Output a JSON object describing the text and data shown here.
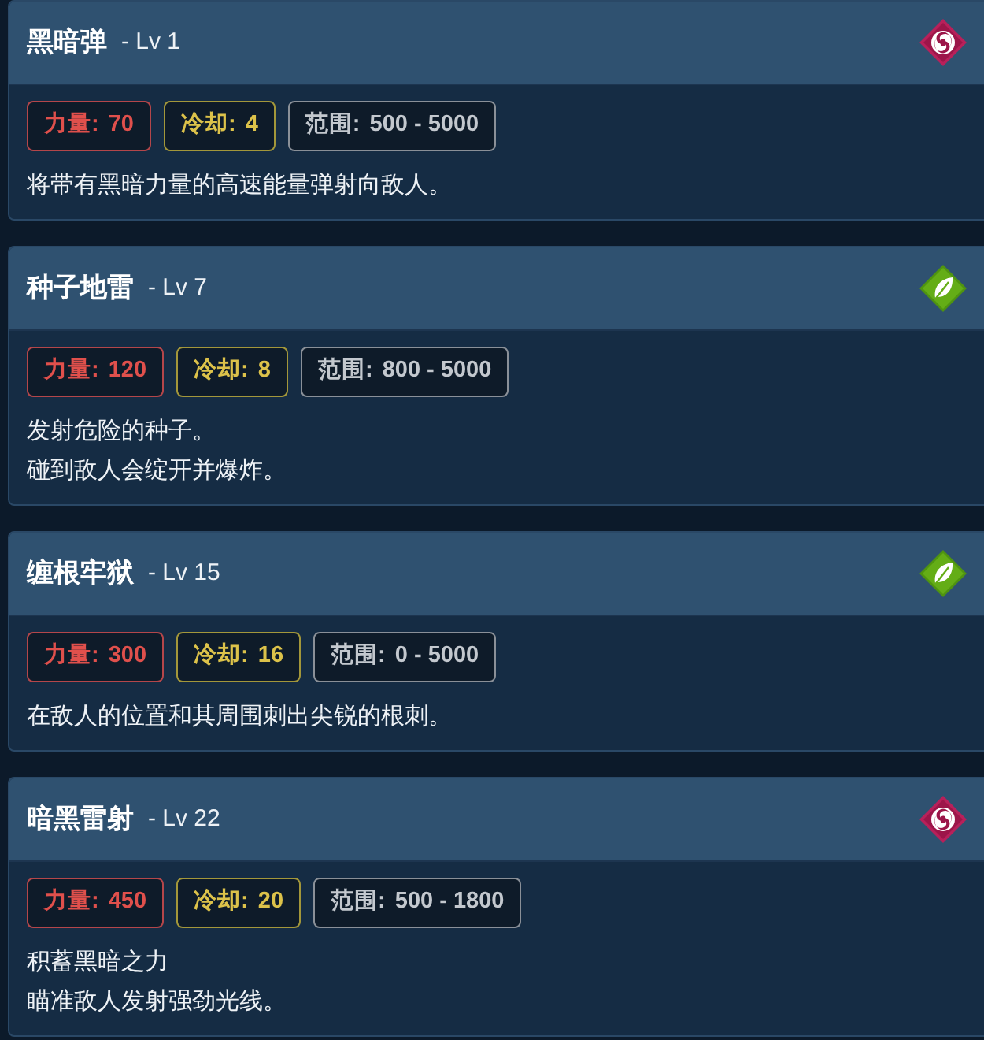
{
  "skills": [
    {
      "name": "黑暗弹",
      "level_text": "- Lv 1",
      "kind": "dark",
      "stats": [
        {
          "kind": "power",
          "label": "力量:",
          "value": "70"
        },
        {
          "kind": "cooldown",
          "label": "冷却:",
          "value": "4"
        },
        {
          "kind": "range",
          "label": "范围:",
          "value": "500 - 5000"
        }
      ],
      "description_lines": [
        "将带有黑暗力量的高速能量弹射向敌人。"
      ]
    },
    {
      "name": "种子地雷",
      "level_text": "- Lv 7",
      "kind": "nature",
      "stats": [
        {
          "kind": "power",
          "label": "力量:",
          "value": "120"
        },
        {
          "kind": "cooldown",
          "label": "冷却:",
          "value": "8"
        },
        {
          "kind": "range",
          "label": "范围:",
          "value": "800 - 5000"
        }
      ],
      "description_lines": [
        "发射危险的种子。",
        "碰到敌人会绽开并爆炸。"
      ]
    },
    {
      "name": "缠根牢狱",
      "level_text": "- Lv 15",
      "kind": "nature",
      "stats": [
        {
          "kind": "power",
          "label": "力量:",
          "value": "300"
        },
        {
          "kind": "cooldown",
          "label": "冷却:",
          "value": "16"
        },
        {
          "kind": "range",
          "label": "范围:",
          "value": "0 - 5000"
        }
      ],
      "description_lines": [
        "在敌人的位置和其周围刺出尖锐的根刺。"
      ]
    },
    {
      "name": "暗黑雷射",
      "level_text": "- Lv 22",
      "kind": "dark",
      "stats": [
        {
          "kind": "power",
          "label": "力量:",
          "value": "450"
        },
        {
          "kind": "cooldown",
          "label": "冷却:",
          "value": "20"
        },
        {
          "kind": "range",
          "label": "范围:",
          "value": "500 - 1800"
        }
      ],
      "description_lines": [
        "积蓄黑暗之力",
        "瞄准敌人发射强劲光线。"
      ]
    }
  ]
}
